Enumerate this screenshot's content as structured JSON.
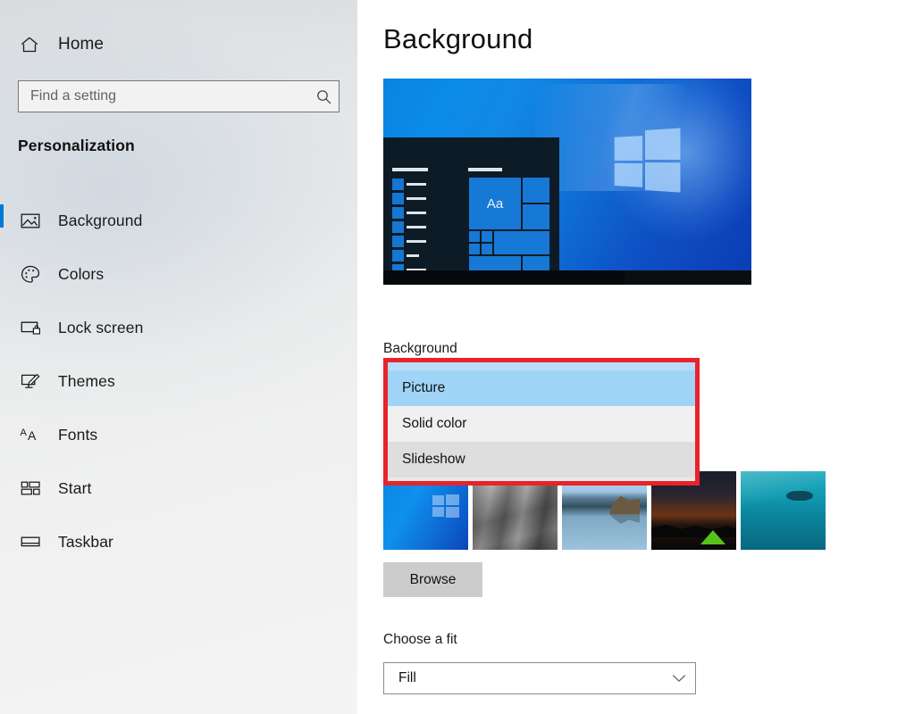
{
  "sidebar": {
    "home": {
      "label": "Home",
      "icon": "home-icon"
    },
    "search": {
      "placeholder": "Find a setting",
      "value": "",
      "icon": "search-icon"
    },
    "section_title": "Personalization",
    "items": [
      {
        "label": "Background",
        "icon": "picture-icon",
        "selected": true
      },
      {
        "label": "Colors",
        "icon": "palette-icon",
        "selected": false
      },
      {
        "label": "Lock screen",
        "icon": "lock-screen-icon",
        "selected": false
      },
      {
        "label": "Themes",
        "icon": "themes-brush-icon",
        "selected": false
      },
      {
        "label": "Fonts",
        "icon": "fonts-aa-icon",
        "selected": false
      },
      {
        "label": "Start",
        "icon": "start-tiles-icon",
        "selected": false
      },
      {
        "label": "Taskbar",
        "icon": "taskbar-icon",
        "selected": false
      }
    ]
  },
  "main": {
    "page_title": "Background",
    "preview": {
      "alt": "desktop-preview",
      "start_menu_text": "Aa"
    },
    "background_label": "Background",
    "background_dropdown": {
      "expanded": true,
      "selected": "Picture",
      "options": [
        {
          "label": "Picture",
          "state": "selected"
        },
        {
          "label": "Solid color",
          "state": "normal"
        },
        {
          "label": "Slideshow",
          "state": "hover"
        }
      ]
    },
    "thumbnails": [
      {
        "name": "windows-blue-wallpaper"
      },
      {
        "name": "grayscale-rock-wall"
      },
      {
        "name": "beach-sea-stack"
      },
      {
        "name": "night-camp-tent"
      },
      {
        "name": "underwater-teal"
      }
    ],
    "browse_label": "Browse",
    "fit_label": "Choose a fit",
    "fit_value": "Fill"
  },
  "colors": {
    "accent": "#0078d7",
    "highlight_box": "#e8232a",
    "dropdown_selected": "#9fd4f7",
    "button_face": "#cccccc"
  }
}
